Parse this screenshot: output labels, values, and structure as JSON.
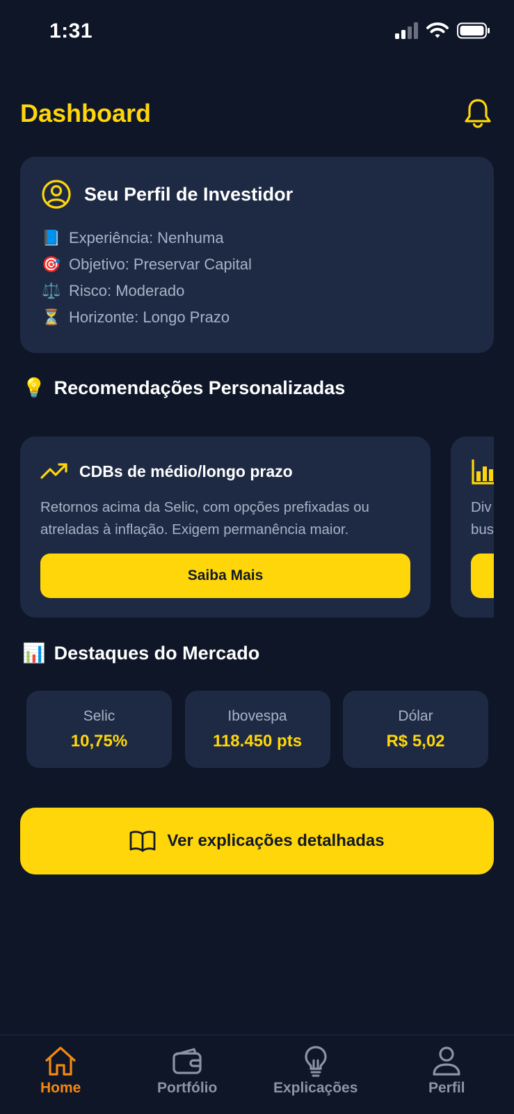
{
  "status_bar": {
    "time": "1:31"
  },
  "header": {
    "title": "Dashboard"
  },
  "profile": {
    "title": "Seu Perfil de Investidor",
    "lines": [
      {
        "emoji": "📘",
        "text": "Experiência: Nenhuma"
      },
      {
        "emoji": "🎯",
        "text": "Objetivo: Preservar Capital"
      },
      {
        "emoji": "⚖️",
        "text": "Risco: Moderado"
      },
      {
        "emoji": "⏳",
        "text": "Horizonte: Longo Prazo"
      }
    ]
  },
  "recommendations": {
    "emoji": "💡",
    "title": "Recomendações Personalizadas",
    "cards": [
      {
        "icon": "trending-up-icon",
        "title": "CDBs de médio/longo prazo",
        "description_line1": "Retornos acima da Selic, com opções prefixadas ou",
        "description_line2": "atreladas à inflação. Exigem permanência maior.",
        "button": "Saiba Mais"
      },
      {
        "icon": "bar-chart-icon",
        "description_line1": "Div",
        "description_line2": "bus"
      }
    ]
  },
  "market": {
    "emoji": "📊",
    "title": "Destaques do Mercado",
    "items": [
      {
        "label": "Selic",
        "value": "10,75%"
      },
      {
        "label": "Ibovespa",
        "value": "118.450 pts"
      },
      {
        "label": "Dólar",
        "value": "R$ 5,02"
      }
    ]
  },
  "details_button": {
    "icon": "book-open-icon",
    "label": "Ver explicações detalhadas"
  },
  "bottom_nav": {
    "items": [
      {
        "label": "Home",
        "icon": "home-icon",
        "active": true
      },
      {
        "label": "Portfólio",
        "icon": "wallet-icon"
      },
      {
        "label": "Explicações",
        "icon": "lightbulb-icon"
      },
      {
        "label": "Perfil",
        "icon": "user-icon"
      }
    ]
  },
  "colors": {
    "background": "#0e1628",
    "card": "#1e2a44",
    "accent_yellow": "#ffd60a",
    "nav_active": "#f5880e",
    "muted_text": "#a9b2c6"
  }
}
